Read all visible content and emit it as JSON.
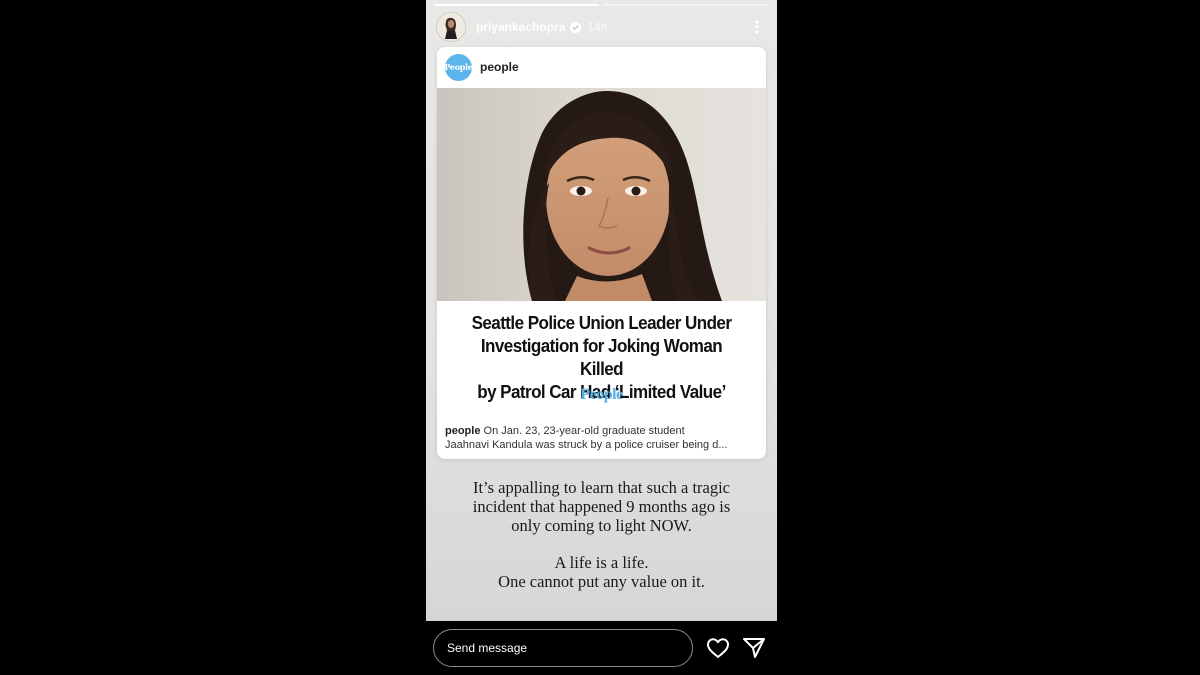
{
  "story": {
    "username": "priyankachopra",
    "time": "14h",
    "progress": [
      1.0,
      0.0
    ]
  },
  "card": {
    "account": "people",
    "logo_text": "People",
    "headline_lines": [
      "Seattle Police Union Leader Under",
      "Investigation for Joking Woman Killed",
      "by Patrol Car Had ‘Limited Value’"
    ],
    "brand": "People",
    "caption_user": "people",
    "caption_line1": "On Jan. 23, 23-year-old graduate student",
    "caption_line2": "Jaahnavi Kandula was struck by a police cruiser being d..."
  },
  "overlay_text": {
    "para1": [
      "It’s appalling to learn that such a tragic",
      "incident that happened 9 months ago is",
      "only coming to light NOW."
    ],
    "para2": [
      "A life is a life.",
      "One cannot put any value on it."
    ]
  },
  "footer": {
    "send_placeholder": "Send message"
  },
  "colors": {
    "people_brand": "#57aee3",
    "people_logo_bg": "#5bb5ea"
  },
  "icons": [
    "verified-badge-icon",
    "more-options-icon",
    "heart-icon",
    "send-icon"
  ]
}
